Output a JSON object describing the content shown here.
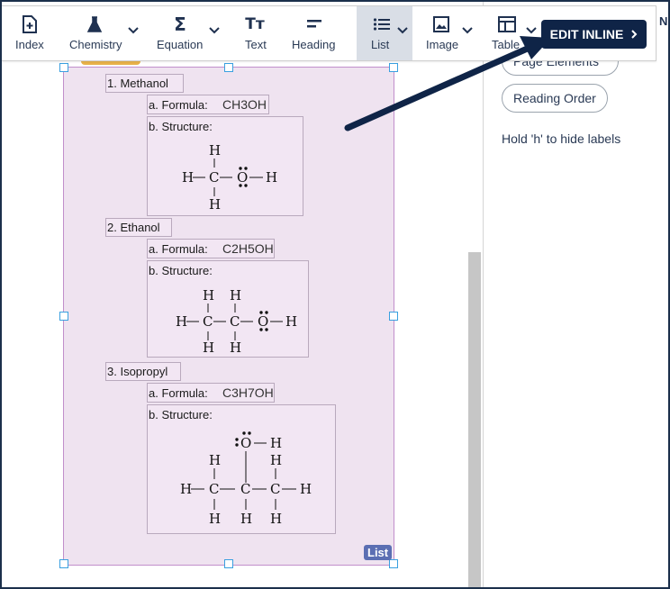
{
  "toolbar": {
    "tools": [
      {
        "label": "Index",
        "icon": "add-document-icon"
      },
      {
        "label": "Chemistry",
        "icon": "flask-icon"
      },
      {
        "label": "Equation",
        "icon": "sigma-icon"
      },
      {
        "label": "Text",
        "icon": "text-icon"
      },
      {
        "label": "Heading",
        "icon": "heading-icon"
      },
      {
        "label": "List",
        "icon": "list-icon",
        "active": true
      },
      {
        "label": "Image",
        "icon": "image-icon"
      },
      {
        "label": "Table",
        "icon": "table-icon"
      }
    ],
    "edit_inline_label": "EDIT INLINE",
    "overflow_letter": "N",
    "glyphs": {
      "sigma": "Σ",
      "text": "Tт"
    }
  },
  "document": {
    "selection_tag": "List",
    "items": [
      {
        "title": "1.  Methanol",
        "formula_label": "a.  Formula:",
        "formula": "CH3OH",
        "structure_label": "b.  Structure:"
      },
      {
        "title": "2.  Ethanol",
        "formula_label": "a.  Formula:",
        "formula": "C2H5OH",
        "structure_label": "b.  Structure:"
      },
      {
        "title": "3.  Isopropyl",
        "formula_label": "a.  Formula:",
        "formula": "C3H7OH",
        "structure_label": "b.  Structure:"
      }
    ],
    "structure_atoms": {
      "h": "H",
      "c": "C",
      "o": "O"
    }
  },
  "right_panel": {
    "page_elements_label": "Page Elements",
    "reading_order_label": "Reading Order",
    "hint": "Hold 'h' to hide labels"
  },
  "colors": {
    "selection_fill": "#efe3f0",
    "selection_border": "#c18fcb",
    "edit_inline_bg": "#0f2447",
    "active_tool_bg": "#d9dee6",
    "tag_chip": "#5b6fb3"
  }
}
